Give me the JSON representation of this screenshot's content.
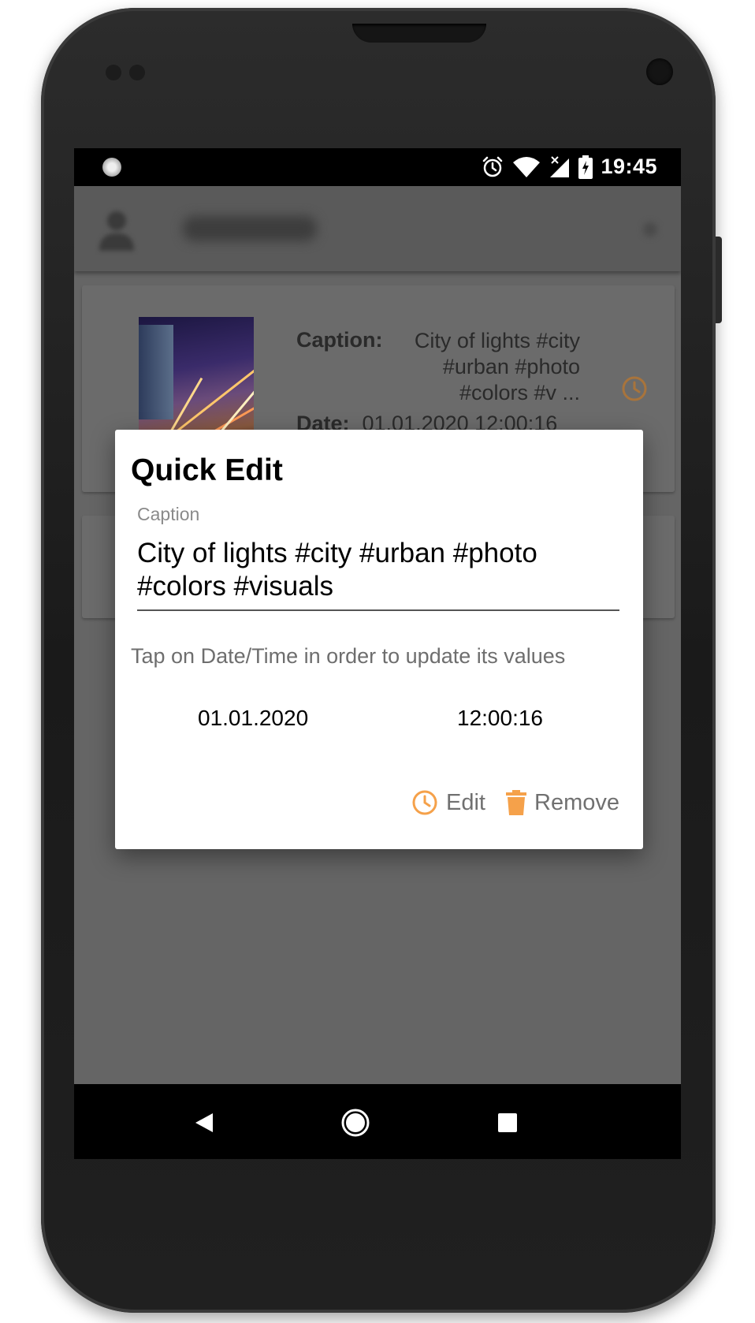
{
  "status_bar": {
    "time": "19:45"
  },
  "app_bar": {
    "username": "@cankut"
  },
  "card": {
    "caption_label": "Caption:",
    "caption_preview": "City of lights #city #urban #photo #colors #v ...",
    "date_label": "Date:",
    "date_value": "01.01.2020 12:00:16"
  },
  "dialog": {
    "title": "Quick Edit",
    "caption_field_label": "Caption",
    "caption_value": "City of lights #city #urban #photo #colors #visuals",
    "hint": "Tap on Date/Time in order to update its values",
    "date": "01.01.2020",
    "time": "12:00:16",
    "edit_label": "Edit",
    "remove_label": "Remove"
  },
  "colors": {
    "accent": "#F5A14A",
    "scrim": "#656565"
  },
  "icons": [
    "alarm-icon",
    "wifi-icon",
    "signal-icon",
    "battery-icon",
    "clock-icon",
    "trash-icon",
    "back-icon",
    "home-icon",
    "recents-icon"
  ]
}
